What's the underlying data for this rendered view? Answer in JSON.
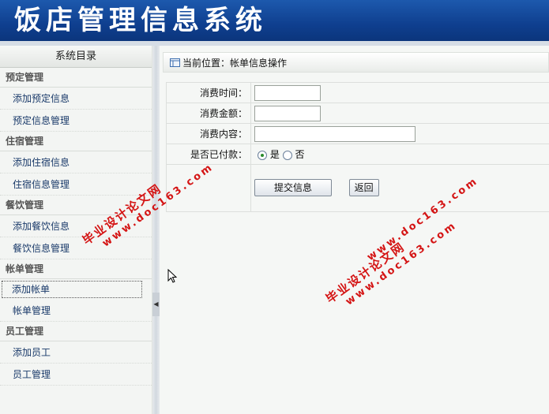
{
  "app": {
    "title": "饭店管理信息系统"
  },
  "sidebar": {
    "title": "系统目录",
    "groups": [
      {
        "heading": "预定管理",
        "items": [
          "添加预定信息",
          "预定信息管理"
        ]
      },
      {
        "heading": "住宿管理",
        "items": [
          "添加住宿信息",
          "住宿信息管理"
        ]
      },
      {
        "heading": "餐饮管理",
        "items": [
          "添加餐饮信息",
          "餐饮信息管理"
        ]
      },
      {
        "heading": "帐单管理",
        "items": [
          "添加帐单",
          "帐单管理"
        ]
      },
      {
        "heading": "员工管理",
        "items": [
          "添加员工",
          "员工管理"
        ]
      }
    ],
    "active_item": "添加帐单"
  },
  "breadcrumb": {
    "text": "当前位置：帐单信息操作"
  },
  "form": {
    "fields": [
      {
        "label": "消费时间：",
        "value": ""
      },
      {
        "label": "消费金额：",
        "value": ""
      },
      {
        "label": "消费内容：",
        "value": ""
      }
    ],
    "paid_label": "是否已付款：",
    "paid_options": [
      "是",
      "否"
    ],
    "paid_selected": "是",
    "submit_label": "提交信息",
    "back_label": "返回"
  },
  "watermark": {
    "line1": "毕业设计论文网",
    "line2": "www.doc163.com"
  },
  "colors": {
    "header_blue": "#154a9c",
    "link_text": "#1a3a6a",
    "watermark_red": "#d41414"
  }
}
